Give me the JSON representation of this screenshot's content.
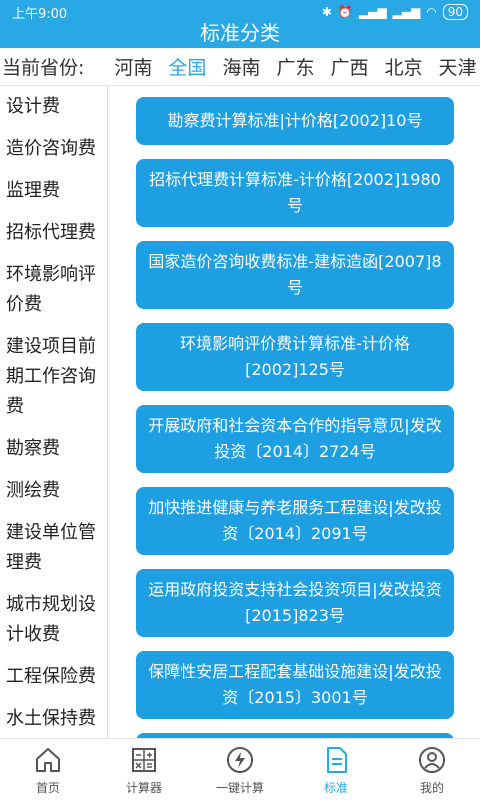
{
  "status_bar": {
    "time": "上午9:00",
    "battery": "90"
  },
  "header": {
    "title": "标准分类"
  },
  "province_bar": {
    "label": "当前省份:",
    "items": [
      "河南",
      "全国",
      "海南",
      "广东",
      "广西",
      "北京",
      "天津"
    ],
    "active": "全国"
  },
  "sidebar": {
    "items": [
      "设计费",
      "造价咨询费",
      "监理费",
      "招标代理费",
      "环境影响评价费",
      "建设项目前期工作咨询费",
      "勘察费",
      "测绘费",
      "建设单位管理费",
      "城市规划设计收费",
      "工程保险费",
      "水土保持费"
    ]
  },
  "content": {
    "cards": [
      "勘察费计算标准|计价格[2002]10号",
      "招标代理费计算标准-计价格[2002]1980号",
      "国家造价咨询收费标准-建标造函[2007]8号",
      "环境影响评价费计算标准-计价格[2002]125号",
      "开展政府和社会资本合作的指导意见|发改投资〔2014〕2724号",
      "加快推进健康与养老服务工程建设|发改投资〔2014〕2091号",
      "运用政府投资支持社会投资项目|发改投资[2015]823号",
      "保障性安居工程配套基础设施建设|发改投资〔2015〕3001号",
      ""
    ]
  },
  "tabbar": {
    "items": [
      {
        "label": "首页",
        "icon": "home-icon"
      },
      {
        "label": "计算器",
        "icon": "calculator-icon"
      },
      {
        "label": "一键计算",
        "icon": "lightning-icon"
      },
      {
        "label": "标准",
        "icon": "document-icon"
      },
      {
        "label": "我的",
        "icon": "user-icon"
      }
    ],
    "active": "标准"
  },
  "colors": {
    "primary": "#29A8E6",
    "card": "#1E9FE2"
  }
}
